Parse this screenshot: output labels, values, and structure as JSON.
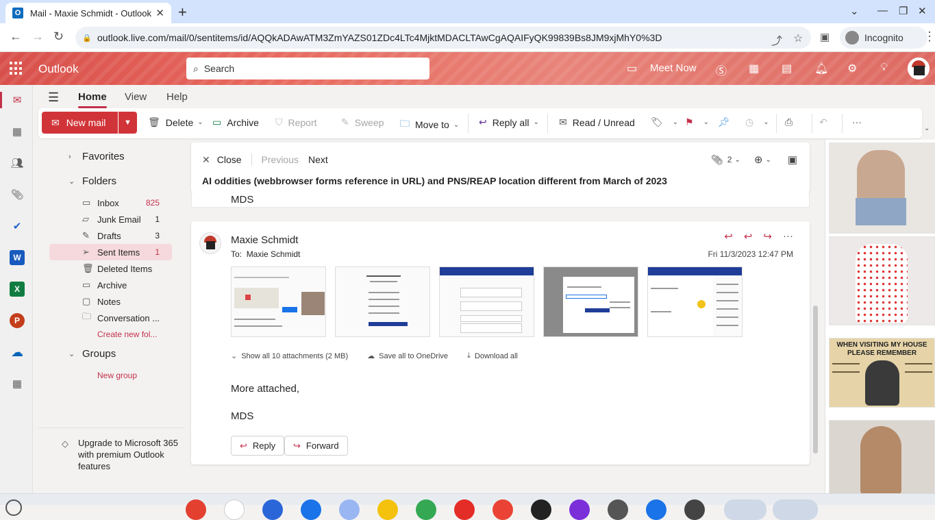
{
  "browser": {
    "tab_title": "Mail - Maxie Schmidt - Outlook",
    "url": "outlook.live.com/mail/0/sentitems/id/AQQkADAwATM3ZmYAZS01ZDc4LTc4MjktMDACLTAwCgAQAIFyQK99839Bs8JM9xjMhY0%3D",
    "profile": "Incognito"
  },
  "header": {
    "app_name": "Outlook",
    "search_placeholder": "Search",
    "meet_now": "Meet Now"
  },
  "ribbon": {
    "tabs": [
      "Home",
      "View",
      "Help"
    ],
    "active_tab": "Home",
    "new_mail": "New mail",
    "delete": "Delete",
    "archive": "Archive",
    "report": "Report",
    "sweep": "Sweep",
    "move_to": "Move to",
    "reply_all": "Reply all",
    "read_unread": "Read / Unread"
  },
  "folders": {
    "favorites": "Favorites",
    "folders_label": "Folders",
    "items": [
      {
        "label": "Inbox",
        "count": "825"
      },
      {
        "label": "Junk Email",
        "count": "1"
      },
      {
        "label": "Drafts",
        "count": "3"
      },
      {
        "label": "Sent Items",
        "count": "1"
      },
      {
        "label": "Deleted Items",
        "count": ""
      },
      {
        "label": "Archive",
        "count": ""
      },
      {
        "label": "Notes",
        "count": ""
      },
      {
        "label": "Conversation ...",
        "count": ""
      }
    ],
    "create_new": "Create new fol...",
    "groups": "Groups",
    "new_group": "New group",
    "upsell": "Upgrade to Microsoft 365 with premium Outlook features"
  },
  "reading": {
    "close": "Close",
    "previous": "Previous",
    "next": "Next",
    "attachment_count": "2",
    "subject": "AI oddities (webbrowser forms reference in URL) and PNS/REAP location different from March of 2023",
    "prev_snippet": "MDS",
    "message": {
      "sender": "Maxie Schmidt",
      "to_label": "To:",
      "to": "Maxie Schmidt",
      "date": "Fri 11/3/2023 12:47 PM",
      "show_all": "Show all 10 attachments (2 MB)",
      "save_onedrive": "Save all to OneDrive",
      "download_all": "Download all",
      "body_line1": "More attached,",
      "body_line2": "MDS",
      "reply": "Reply",
      "forward": "Forward"
    }
  },
  "ads": {
    "ad3_text1": "WHEN VISITING MY HOUSE",
    "ad3_text2": "PLEASE REMEMBER"
  },
  "colors": {
    "accent": "#c4314b",
    "new_mail": "#d13438",
    "header": "#e06a62"
  }
}
